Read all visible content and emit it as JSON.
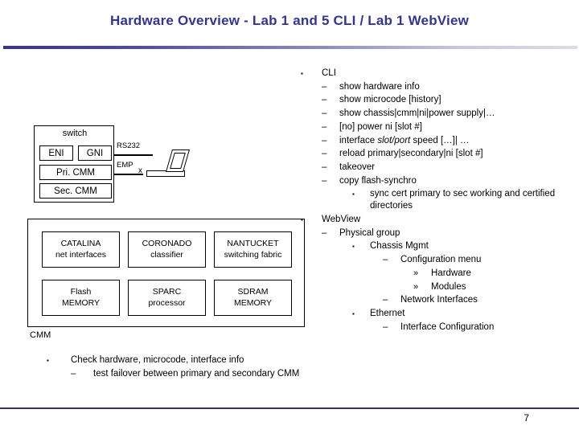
{
  "slide": {
    "title": "Hardware Overview - Lab 1 and 5 CLI / Lab 1 WebView",
    "page_number": "7",
    "accent_color": "#333399",
    "rule_color": "#333366"
  },
  "switch_diagram": {
    "caption": "switch",
    "boxes": [
      {
        "label": "ENI"
      },
      {
        "label": "GNI"
      },
      {
        "label": "Pri. CMM"
      },
      {
        "label": "Sec. CMM"
      }
    ],
    "cables": [
      {
        "label": "RS232"
      },
      {
        "label": "EMP"
      }
    ],
    "connector_marker": "x"
  },
  "cmm_diagram": {
    "caption": "CMM",
    "cells": [
      {
        "name": "CATALINA",
        "role": "net interfaces"
      },
      {
        "name": "CORONADO",
        "role": "classifier"
      },
      {
        "name": "NANTUCKET",
        "role": "switching fabric"
      },
      {
        "name": "Flash",
        "role": "MEMORY"
      },
      {
        "name": "SPARC",
        "role": "processor"
      },
      {
        "name": "SDRAM",
        "role": "MEMORY"
      }
    ]
  },
  "right_list": {
    "cli_heading": "CLI",
    "cli_items": [
      "show hardware info",
      "show microcode [history]",
      "show chassis|cmm|ni|power supply|…",
      "[no] power ni [slot #]",
      "reload primary|secondary|ni [slot #]",
      "takeover",
      "copy flash-synchro"
    ],
    "interface_cmd_pre": "interface ",
    "interface_cmd_italic": "slot/port",
    "interface_cmd_post": " speed […]| …",
    "sync_note": "sync cert primary to sec working and certified directories",
    "webview_heading": "WebView",
    "physical_group": "Physical group",
    "chassis_mgmt": "Chassis Mgmt",
    "configuration_menu": "Configuration menu",
    "hardware": "Hardware",
    "modules": "Modules",
    "network_interfaces": "Network Interfaces",
    "ethernet": "Ethernet",
    "interface_configuration": "Interface Configuration"
  },
  "bottom_list": {
    "item1": "Check hardware, microcode, interface info",
    "item2": "test failover between primary and secondary CMM"
  },
  "marks": {
    "square": "▪",
    "dash": "–",
    "guillemet": "»"
  }
}
